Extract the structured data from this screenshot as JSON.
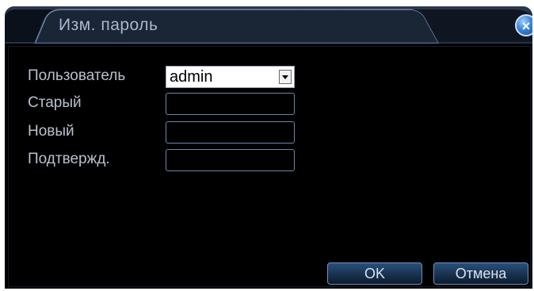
{
  "dialog": {
    "title": "Изм. пароль",
    "close_label": "×"
  },
  "form": {
    "user_label": "Пользователь",
    "user_value": "admin",
    "old_label": "Старый",
    "old_value": "",
    "new_label": "Новый",
    "new_value": "",
    "confirm_label": "Подтвержд.",
    "confirm_value": ""
  },
  "buttons": {
    "ok_label": "OK",
    "cancel_label": "Отмена"
  },
  "colors": {
    "background": "#000000",
    "label_text": "#b8c0cc",
    "title_text": "#a9b7cf",
    "field_border": "#6f86a8",
    "button_gradient_top": "#2a4f7c",
    "close_button": "#3a84d6"
  }
}
